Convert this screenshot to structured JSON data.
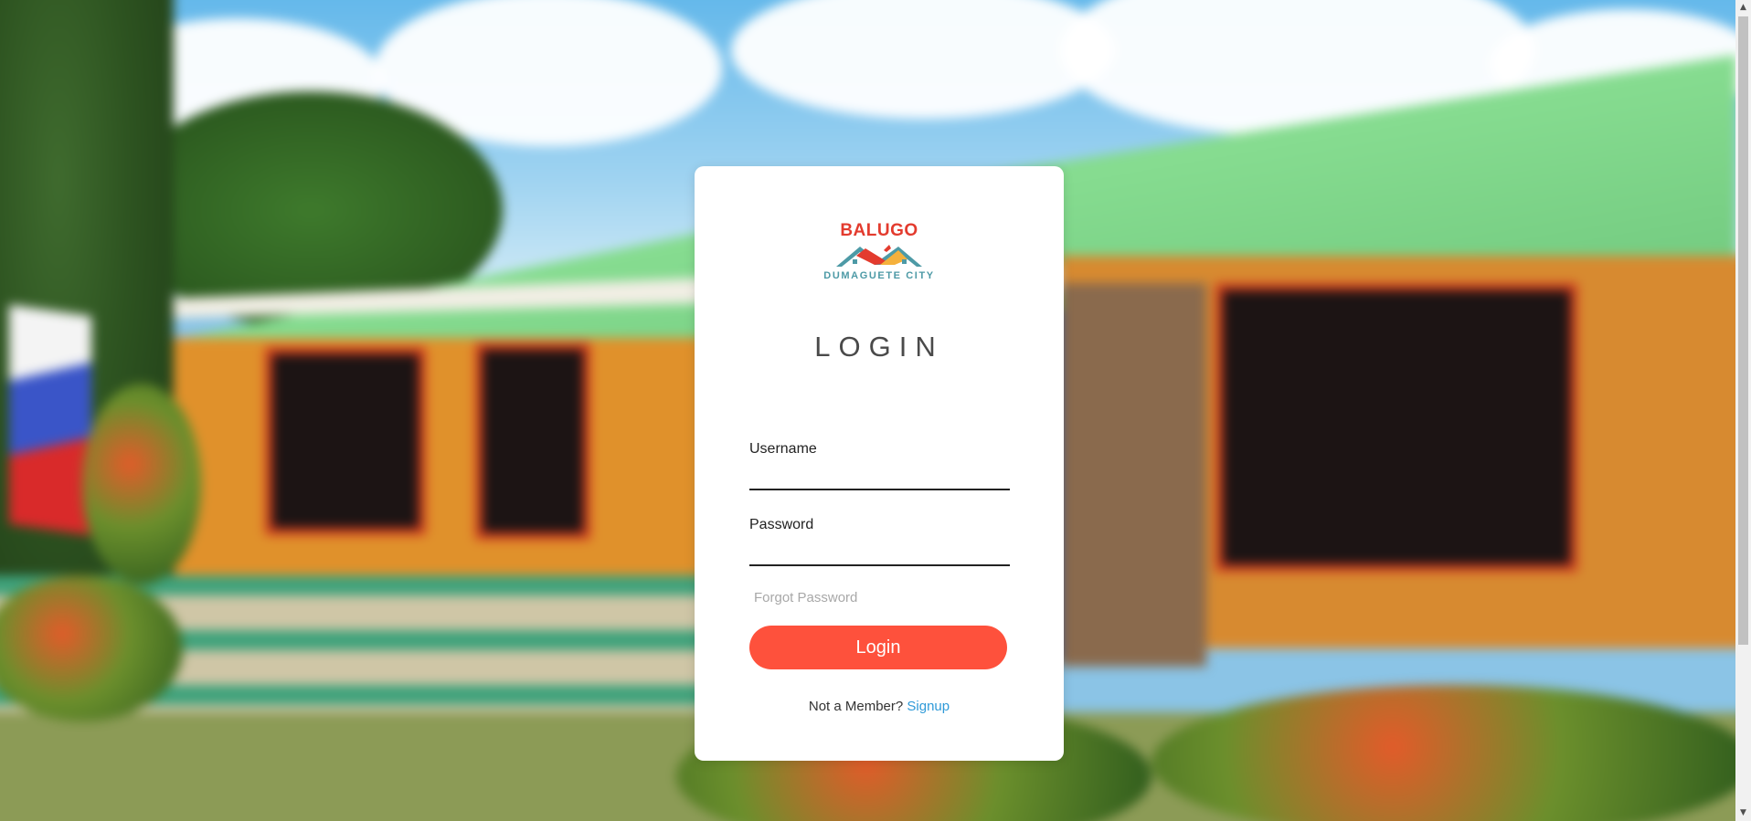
{
  "logo": {
    "top_text": "BALUGO",
    "bottom_text": "DUMAGUETE CITY",
    "icon": "houses-roof-icon"
  },
  "login": {
    "title": "LOGIN",
    "username_label": "Username",
    "username_value": "",
    "password_label": "Password",
    "password_value": "",
    "forgot_password": "Forgot Password",
    "submit_label": "Login",
    "member_prompt": "Not a Member?",
    "signup_label": "Signup"
  },
  "colors": {
    "accent": "#fe513c",
    "link": "#2f9ad8",
    "logo_red": "#e33b2e",
    "logo_teal": "#4d9aa6"
  }
}
